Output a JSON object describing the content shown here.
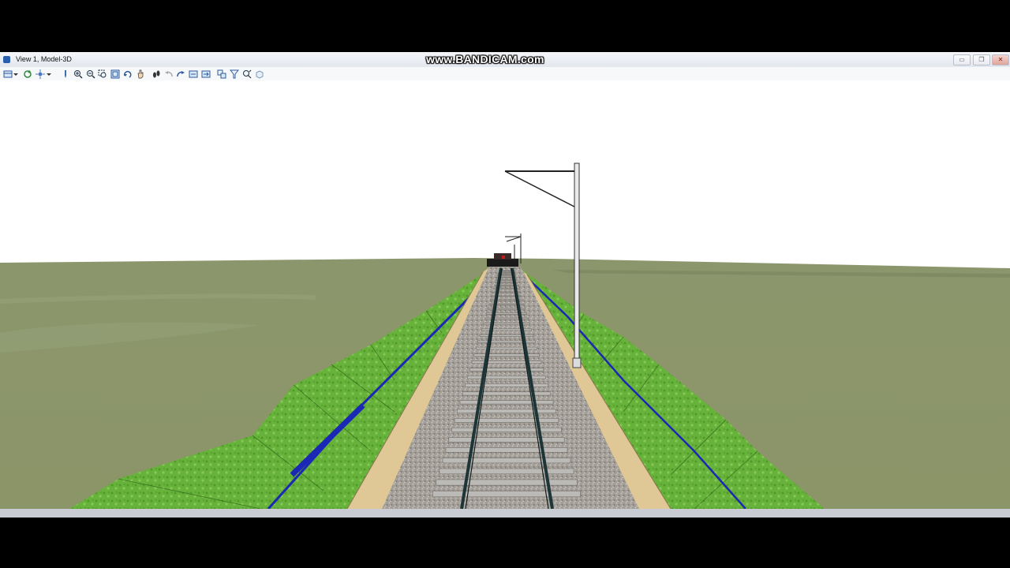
{
  "window": {
    "title": "View 1, Model-3D",
    "watermark": "www.BANDICAM.com",
    "buttons": {
      "minimize": "▭",
      "restore": "❐",
      "close": "✕"
    }
  },
  "toolbar": {
    "icons": [
      "view-attributes-icon",
      "dropdown-arrow-icon",
      "update-view-icon",
      "view-display-icon",
      "dropdown-arrow-icon",
      "pen-icon",
      "zoom-in-icon",
      "zoom-out-icon",
      "window-area-icon",
      "fit-view-icon",
      "rotate-view-icon",
      "pan-view-icon",
      "walk-icon",
      "previous-view-icon",
      "next-view-icon",
      "copy-view-icon",
      "clip-volume-icon",
      "view-camera-icon",
      "navigate-icon",
      "render-icon"
    ]
  },
  "colors": {
    "sky": "#ffffff",
    "terrain": "#8f9a6e",
    "embankment": "#6fb83e",
    "ballast": "#9d9892",
    "sand_strip": "#e2c898",
    "rail": "#1e3a3a",
    "drainage": "#1b27b5"
  }
}
